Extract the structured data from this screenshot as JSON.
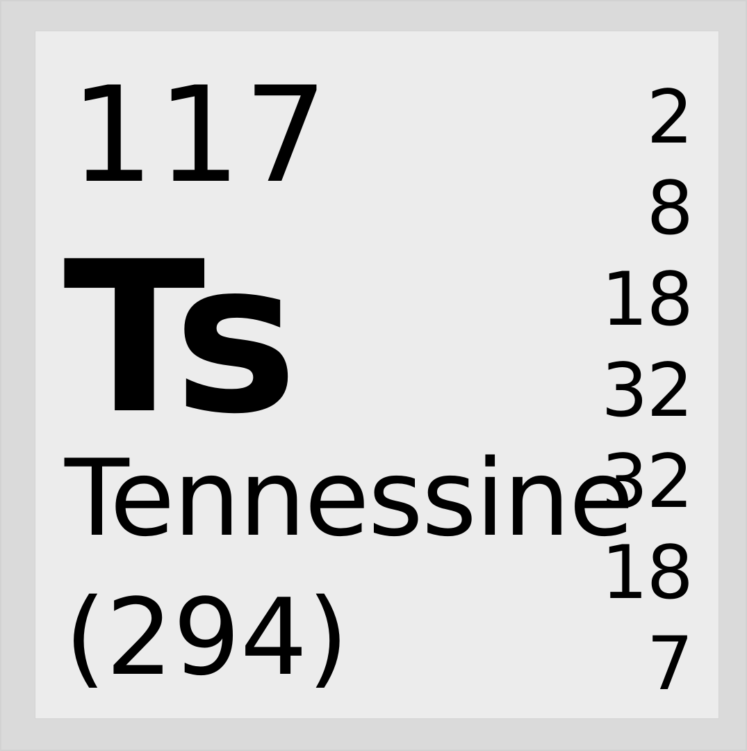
{
  "element": {
    "atomic_number": "117",
    "symbol": "Ts",
    "name": "Tennessine",
    "atomic_mass": "(294)",
    "electron_shells": [
      "2",
      "8",
      "18",
      "32",
      "32",
      "18",
      "7"
    ]
  },
  "colors": {
    "tile_background": "#ececec",
    "frame_background": "#dadada",
    "text": "#000000"
  }
}
